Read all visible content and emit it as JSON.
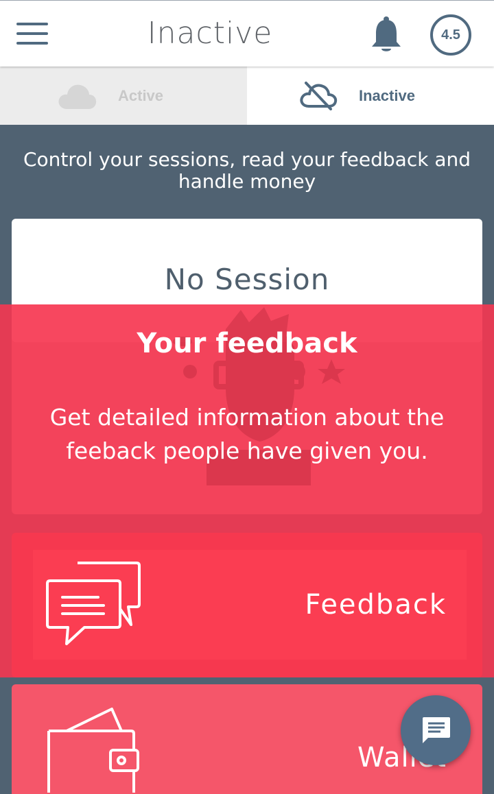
{
  "appbar": {
    "title": "Inactive",
    "rating": "4.5",
    "menu_icon": "hamburger-menu-icon",
    "notification_icon": "bell-icon"
  },
  "tabs": [
    {
      "label": "Active",
      "icon": "cloud-icon",
      "selected": false
    },
    {
      "label": "Inactive",
      "icon": "cloud-off-icon",
      "selected": true
    }
  ],
  "subtitle": "Control your sessions, read your feedback and handle money",
  "session": {
    "status_text": "No Session"
  },
  "tip": {
    "title": "Your feedback",
    "body": "Get detailed information about the feeback people have given you."
  },
  "cards": {
    "feedback": {
      "label": "Feedback",
      "icon": "chat-bubbles-icon"
    },
    "wallet": {
      "label": "Wallet",
      "icon": "wallet-icon"
    }
  },
  "fab": {
    "icon": "message-icon"
  },
  "colors": {
    "primary": "#506a80",
    "background": "#506272",
    "overlay_red": "#f03852",
    "card_red": "#f6384f",
    "wallet_red": "#f5566a"
  }
}
